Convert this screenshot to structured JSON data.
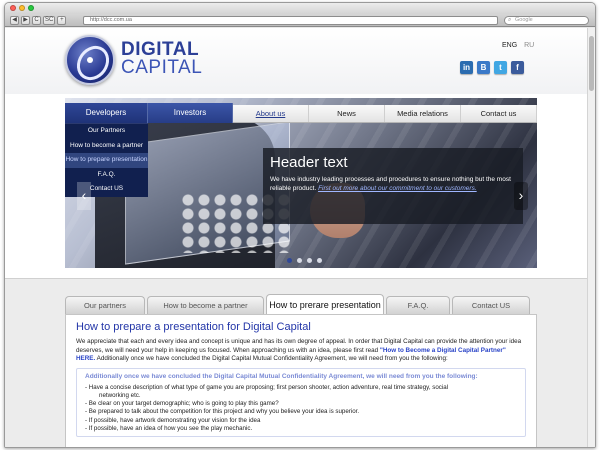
{
  "browser": {
    "url": "http://dcc.com.ua",
    "search_placeholder": "Google",
    "nav_buttons": [
      "◀",
      "▶",
      "C",
      "SC",
      "+"
    ]
  },
  "colors": {
    "brand_blue": "#2c3f97",
    "link_blue": "#2336a8",
    "dropdown_bg": "#11204f"
  },
  "header": {
    "logo_line1": "DIGITAL",
    "logo_line2": "CAPITAL",
    "lang_active": "ENG",
    "lang_inactive": "RU",
    "social": [
      {
        "icon": "linkedin-icon",
        "glyph": "in",
        "color": "#2b6cb0"
      },
      {
        "icon": "blog-icon",
        "glyph": "B",
        "color": "#3a79c8"
      },
      {
        "icon": "twitter-icon",
        "glyph": "t",
        "color": "#41a7e3"
      },
      {
        "icon": "facebook-icon",
        "glyph": "f",
        "color": "#3b5b9c"
      }
    ]
  },
  "nav": {
    "developers": "Developers",
    "investors": "Investors",
    "items": [
      "About us",
      "News",
      "Media relations",
      "Contact us"
    ]
  },
  "dropdown": {
    "items": [
      "Our Partners",
      "How to become a partner",
      "How to prepare presentation",
      "F.A.Q.",
      "Contact US"
    ],
    "active_index": 2
  },
  "hero": {
    "title": "Header text",
    "body": "We have industry leading processes and procedures to ensure nothing but the most reliable product.",
    "link": "First out more about our commitment to our customers.",
    "left_arrow": "‹",
    "right_arrow": "›",
    "slide_count": 4,
    "active_slide": 0
  },
  "content_tabs": {
    "items": [
      "Our partners",
      "How to become a partner",
      "How to prerare presentation",
      "F.A.Q.",
      "Contact US"
    ],
    "active_index": 2
  },
  "article": {
    "title": "How to prepare a presentation for Digital Capital",
    "para_part1": "We appreciate that each and every idea and concept is unique and has its own degree of appeal.  In order that Digital Capital can provide the attention your idea deserves, we will need your help in keeping us focused.  When approaching us with an idea, please first read ",
    "para_link": "\"How to Become a Digital Capital Partner\" HERE.",
    "para_part2": "  Additionally once we have concluded the Digital Capital Mutual Confidentiality Agreement, we will need from you the following:",
    "notice_legend": "Additionally once we have concluded the Digital Capital Mutual Confidentiality Agreement, we will need from you the following:",
    "list": [
      "- Have a concise description of what type of game you are proposing; first person shooter, action adventure, real time strategy, social",
      "networking etc.",
      "- Be clear on your target demographic; who is going to play this game?",
      "- Be prepared to talk about the competition for this project and why you believe your idea is superior.",
      "- If possible, have artwork demonstrating your vision for the idea",
      "- If possible, have an idea of how you see the play mechanic."
    ]
  }
}
